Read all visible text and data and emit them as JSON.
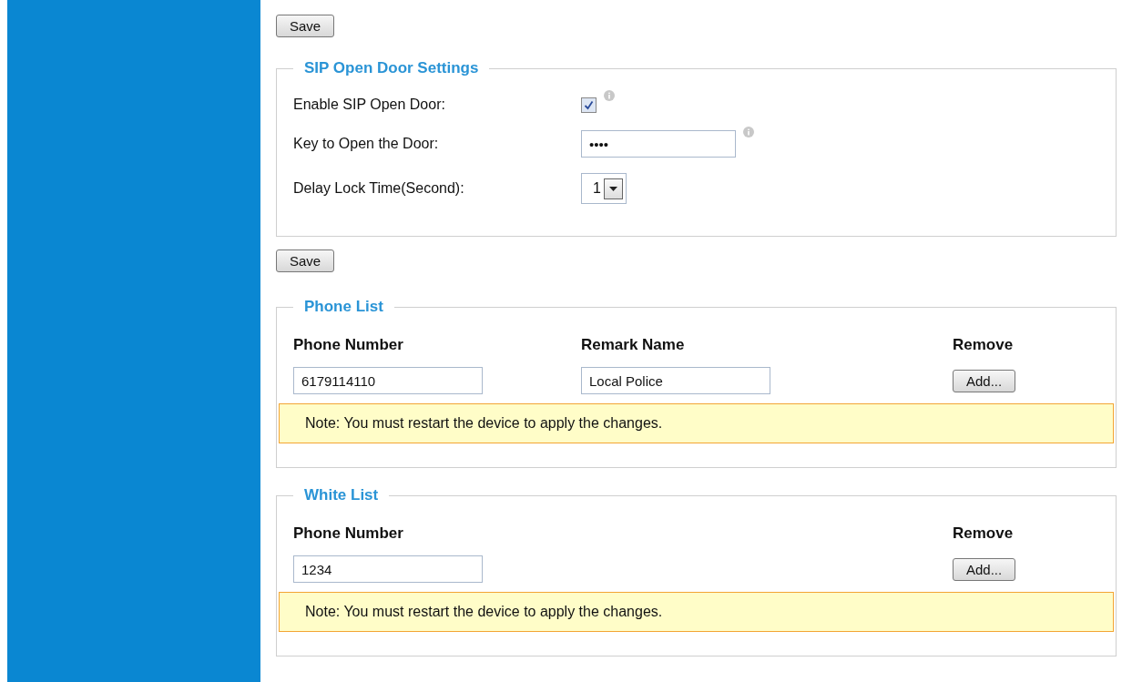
{
  "save_buttons": [
    "Save",
    "Save"
  ],
  "sip_open_door": {
    "legend": "SIP Open Door Settings",
    "enable": {
      "label": "Enable SIP Open Door:",
      "checked": true
    },
    "key": {
      "label": "Key to Open the Door:",
      "value": "••••"
    },
    "delay": {
      "label": "Delay Lock Time(Second):",
      "value": "1"
    }
  },
  "lists": [
    {
      "legend": "Phone List",
      "columns": [
        "Phone Number",
        "Remark Name",
        "Remove"
      ],
      "rows": [
        {
          "phone": "6179114110",
          "remark": "Local Police",
          "action": "Add..."
        }
      ],
      "note": "Note: You must restart the device to apply the changes."
    },
    {
      "legend": "White List",
      "columns": [
        "Phone Number",
        "Remove"
      ],
      "rows": [
        {
          "phone": "1234",
          "action": "Add..."
        }
      ],
      "note": "Note: You must restart the device to apply the changes."
    }
  ]
}
